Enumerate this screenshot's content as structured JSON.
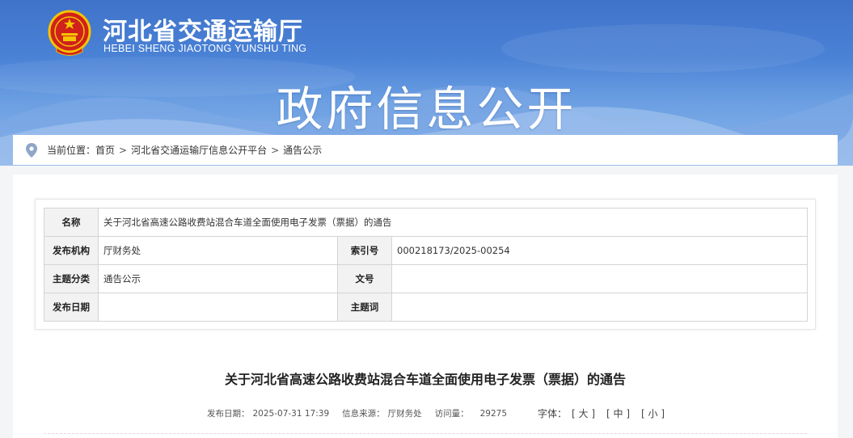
{
  "site": {
    "title": "河北省交通运输厅",
    "subtitle": "HEBEI SHENG JIAOTONG YUNSHU TING"
  },
  "banner": {
    "title": "政府信息公开"
  },
  "breadcrumb": {
    "prefix": "当前位置：",
    "items": [
      "首页",
      "河北省交通运输厅信息公开平台",
      "通告公示"
    ],
    "separator": ">"
  },
  "info_table": {
    "name_label": "名称",
    "name_value": "关于河北省高速公路收费站混合车道全面使用电子发票（票据）的通告",
    "org_label": "发布机构",
    "org_value": "厅财务处",
    "index_label": "索引号",
    "index_value": "000218173/2025-00254",
    "category_label": "主题分类",
    "category_value": "通告公示",
    "docno_label": "文号",
    "docno_value": "",
    "date_label": "发布日期",
    "date_value": "",
    "keywords_label": "主题词",
    "keywords_value": ""
  },
  "article": {
    "title": "关于河北省高速公路收费站混合车道全面使用电子发票（票据）的通告",
    "date_label": "发布日期：",
    "date_value": "2025-07-31 17:39",
    "source_label": "信息来源：",
    "source_value": "厅财务处",
    "views_label": "访问量：",
    "views_value": "29275",
    "font_label": "字体：",
    "font_large": "[ 大 ]",
    "font_medium": "[ 中 ]",
    "font_small": "[ 小 ]"
  },
  "colors": {
    "banner_top": "#3f73c9",
    "banner_bottom": "#8ab5ea",
    "emblem_red": "#d0211c",
    "emblem_gold": "#f5c400"
  }
}
